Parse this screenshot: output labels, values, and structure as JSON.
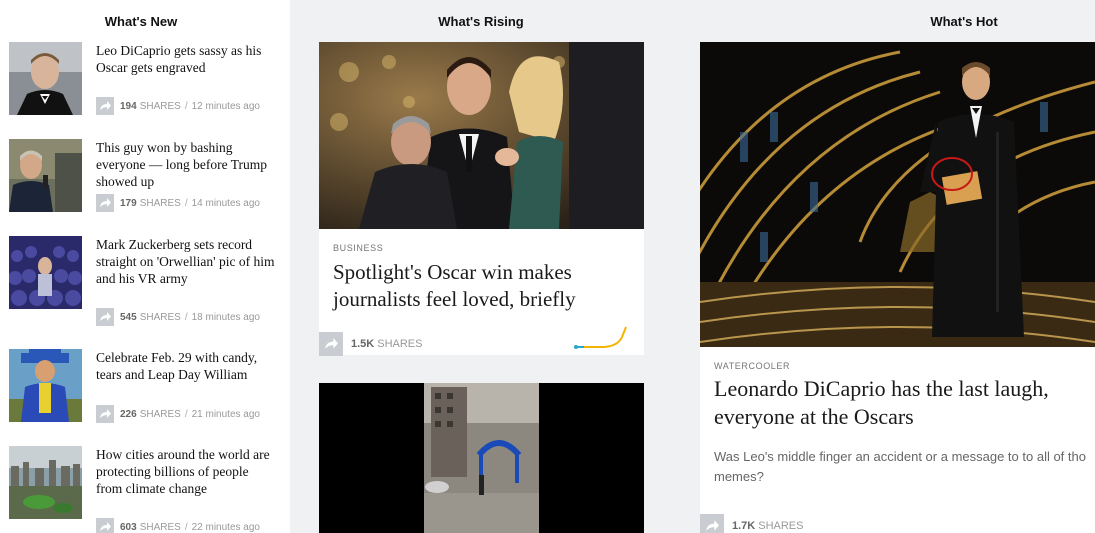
{
  "columns": {
    "new": "What's New",
    "rising": "What's Rising",
    "hot": "What's Hot"
  },
  "news": [
    {
      "headline": "Leo DiCaprio gets sassy as his Oscar gets engraved",
      "count": "194",
      "shares": "SHARES",
      "time": "12 minutes ago"
    },
    {
      "headline": "This guy won by bashing everyone — long before Trump showed up",
      "count": "179",
      "shares": "SHARES",
      "time": "14 minutes ago"
    },
    {
      "headline": "Mark Zuckerberg sets record straight on 'Orwellian' pic of him and his VR army",
      "count": "545",
      "shares": "SHARES",
      "time": "18 minutes ago"
    },
    {
      "headline": "Celebrate Feb. 29 with candy, tears and Leap Day William",
      "count": "226",
      "shares": "SHARES",
      "time": "21 minutes ago"
    },
    {
      "headline": "How cities around the world are protecting billions of people from climate change",
      "count": "603",
      "shares": "SHARES",
      "time": "22 minutes ago"
    }
  ],
  "separator": "/",
  "rising": {
    "category": "BUSINESS",
    "headline": "Spotlight's Oscar win makes journalists feel loved, briefly",
    "count": "1.5K",
    "shares": "SHARES"
  },
  "hot": {
    "category": "WATERCOOLER",
    "headline": "Leonardo DiCaprio has the last laugh, everyone at the Oscars",
    "summary": "Was Leo's middle finger an accident or a message to to all of tho memes?",
    "count": "1.7K",
    "shares": "SHARES"
  },
  "icons": {
    "share": "share-arrow-icon",
    "trend": "trend-line-icon"
  },
  "colors": {
    "share_icon_bg": "#c9ccd0",
    "trend_line": "#f5b400",
    "trend_line_start": "#2aa7c9"
  }
}
